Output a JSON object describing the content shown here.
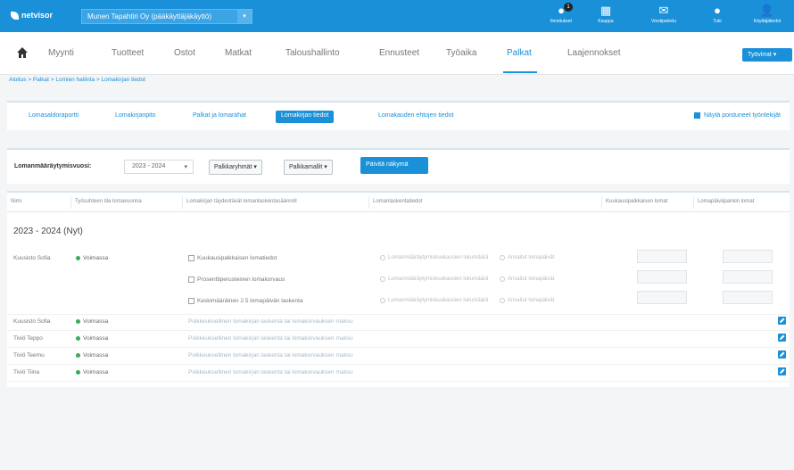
{
  "topbar": {
    "logo_text": "netvisor",
    "company": "Munen Tapahtiri Oy (pääkäyttäjäkäyttö)",
    "company_caret": "▾",
    "icons": [
      {
        "name": "notifications-icon",
        "label": "Ilmoitukset",
        "badge": "1",
        "glyph": "●"
      },
      {
        "name": "store-icon",
        "label": "Kauppa",
        "badge": "",
        "glyph": "▦"
      },
      {
        "name": "messages-icon",
        "label": "Viestipalvelu",
        "badge": "",
        "glyph": "✉"
      },
      {
        "name": "help-icon",
        "label": "Tuki",
        "badge": "",
        "glyph": "●"
      },
      {
        "name": "user-icon",
        "label": "Käyttäjätiedot",
        "badge": "",
        "glyph": "👤"
      }
    ]
  },
  "nav": {
    "items": [
      "Myynti",
      "Tuotteet",
      "Ostot",
      "Matkat",
      "Taloushallinto",
      "Ennusteet",
      "Työaika",
      "Palkat",
      "Laajennokset"
    ],
    "active": "Palkat",
    "vatrepo_label": "Työvirrat ▾"
  },
  "breadcrumb": "Aloitus > Palkat > Lomien hallinta > Lomakirjan tiedot",
  "tabs": {
    "items": [
      "Lomasaldoraportti",
      "Lomakirjanpito",
      "Palkat ja lomarahat",
      "Lomakirjan tiedot",
      "Lomakauden ehtojen tiedot"
    ],
    "active": "Lomakirjan tiedot",
    "checkbox_label": "Näytä poistuneet työntekijät"
  },
  "filters": {
    "label": "Lomanmääräytymisvuosi:",
    "year": "2023 - 2024",
    "dropdown1": "Palkkaryhmät ▾",
    "dropdown2": "Palkkamallit ▾",
    "button": "Päivitä näkymä"
  },
  "table": {
    "headers": [
      "Nimi",
      "Työsuhteen tila lomavuonna",
      "Lomakirjan täydentävät lomanlaskentasäännöt",
      "Lomanlaskentatiedot",
      "",
      "Kuukausipalkkaisen lomat",
      "Lomapäiväpankin lomat"
    ],
    "group_title": "2023 - 2024 (Nyt)",
    "first_row": {
      "name": "Kuusisto Sofia",
      "status": "Voimassa",
      "rules": [
        "Kuukausipalkkaisen lomatiedot",
        "Prosenttiperusteinen lomakorvaus",
        "Keskimääräinen 2.5 lomapäivän laskenta"
      ],
      "opt1": "Lomanmääräytymiskuukausien lukumäärä",
      "opt2": "Ansaitut lomapäivät"
    },
    "rows": [
      {
        "name": "Kuusisto Sofia",
        "status": "Voimassa",
        "rule": "Poikkeuksellinen lomakirjan laskenta tai lomakorvauksen maksu"
      },
      {
        "name": "Tiviö Teppo",
        "status": "Voimassa",
        "rule": "Poikkeuksellinen lomakirjan laskenta tai lomakorvauksen maksu"
      },
      {
        "name": "Tiviö Teemu",
        "status": "Voimassa",
        "rule": "Poikkeuksellinen lomakirjan laskenta tai lomakorvauksen maksu"
      },
      {
        "name": "Tiviö Tiina",
        "status": "Voimassa",
        "rule": "Poikkeuksellinen lomakirjan laskenta tai lomakorvauksen maksu"
      }
    ]
  }
}
